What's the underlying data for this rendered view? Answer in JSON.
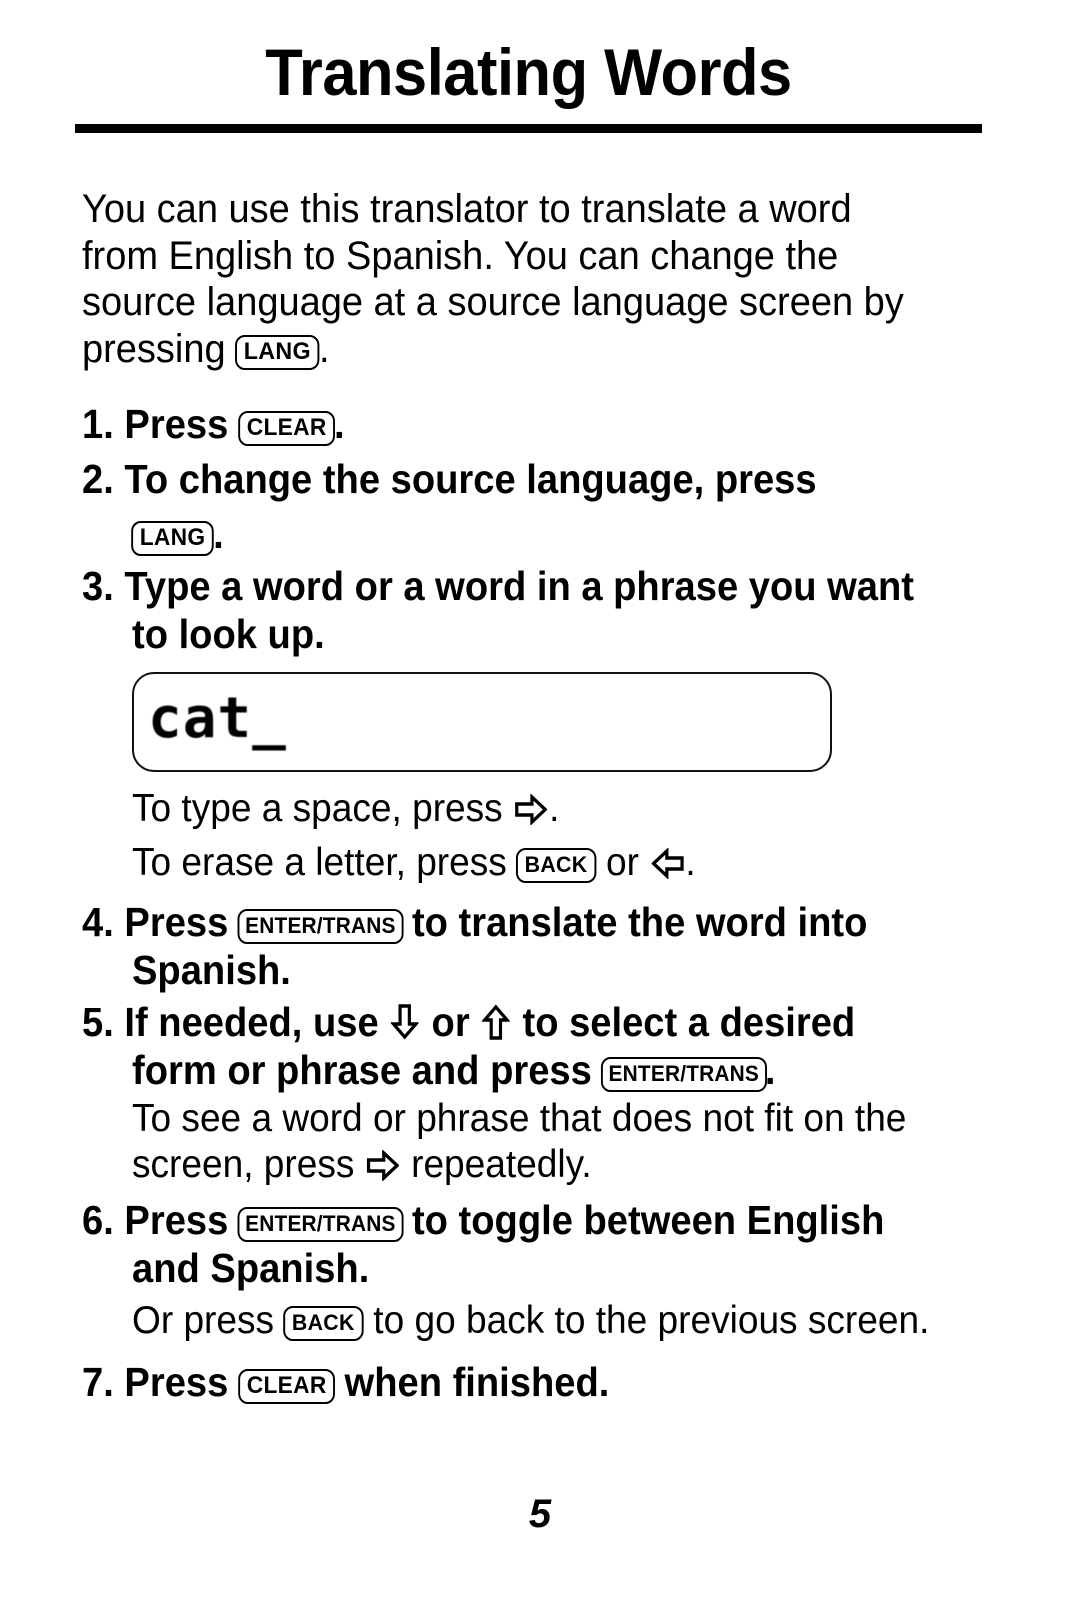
{
  "page": {
    "title": "Translating Words",
    "number": "5"
  },
  "intro": {
    "line1": "You can use this translator to translate a word",
    "line2": "from English to Spanish. You can change the",
    "line3": "source language at a source language screen by",
    "line4_before": "pressing",
    "line4_key": "LANG",
    "line4_after": "."
  },
  "steps": {
    "s1": {
      "number": "1.",
      "before": "Press",
      "key": "CLEAR",
      "after": "."
    },
    "s2": {
      "number": "2.",
      "text": "To change the source language, press",
      "key": "LANG",
      "after": "."
    },
    "s3": {
      "number": "3.",
      "line1": "Type a word or a word in a phrase you want",
      "line2": "to look up."
    },
    "s4": {
      "number": "4.",
      "before": "Press",
      "key": "ENTER/TRANS",
      "after": "to translate the word into",
      "line2": "Spanish."
    },
    "s5": {
      "number": "5.",
      "line1_a": "If needed, use",
      "line1_down_icon": "arrow-down-icon",
      "line1_b": "or",
      "line1_up_icon": "arrow-up-icon",
      "line1_c": "to select a desired",
      "line2_before": "form or phrase and press",
      "line2_key": "ENTER/TRANS",
      "line2_after": "."
    },
    "s6": {
      "number": "6.",
      "before": "Press",
      "key": "ENTER/TRANS",
      "after": "to toggle between English",
      "line2": "and Spanish."
    },
    "s7": {
      "number": "7.",
      "before": "Press",
      "key": "CLEAR",
      "after": "when finished."
    }
  },
  "notes": {
    "space_before": "To type a space, press",
    "space_icon": "arrow-right-icon",
    "space_after": ".",
    "erase_before": "To erase a letter, press",
    "erase_key": "BACK",
    "erase_middle": "or",
    "erase_icon": "arrow-left-icon",
    "erase_after": ".",
    "scroll_line1": "To see a word or phrase that does not fit on the",
    "scroll_line2_before": "screen, press",
    "scroll_icon": "arrow-right-icon",
    "scroll_line2_after": "repeatedly.",
    "back_before": "Or press",
    "back_key": "BACK",
    "back_after": "to go back to the previous screen."
  },
  "lcd": {
    "text": "cat_"
  }
}
